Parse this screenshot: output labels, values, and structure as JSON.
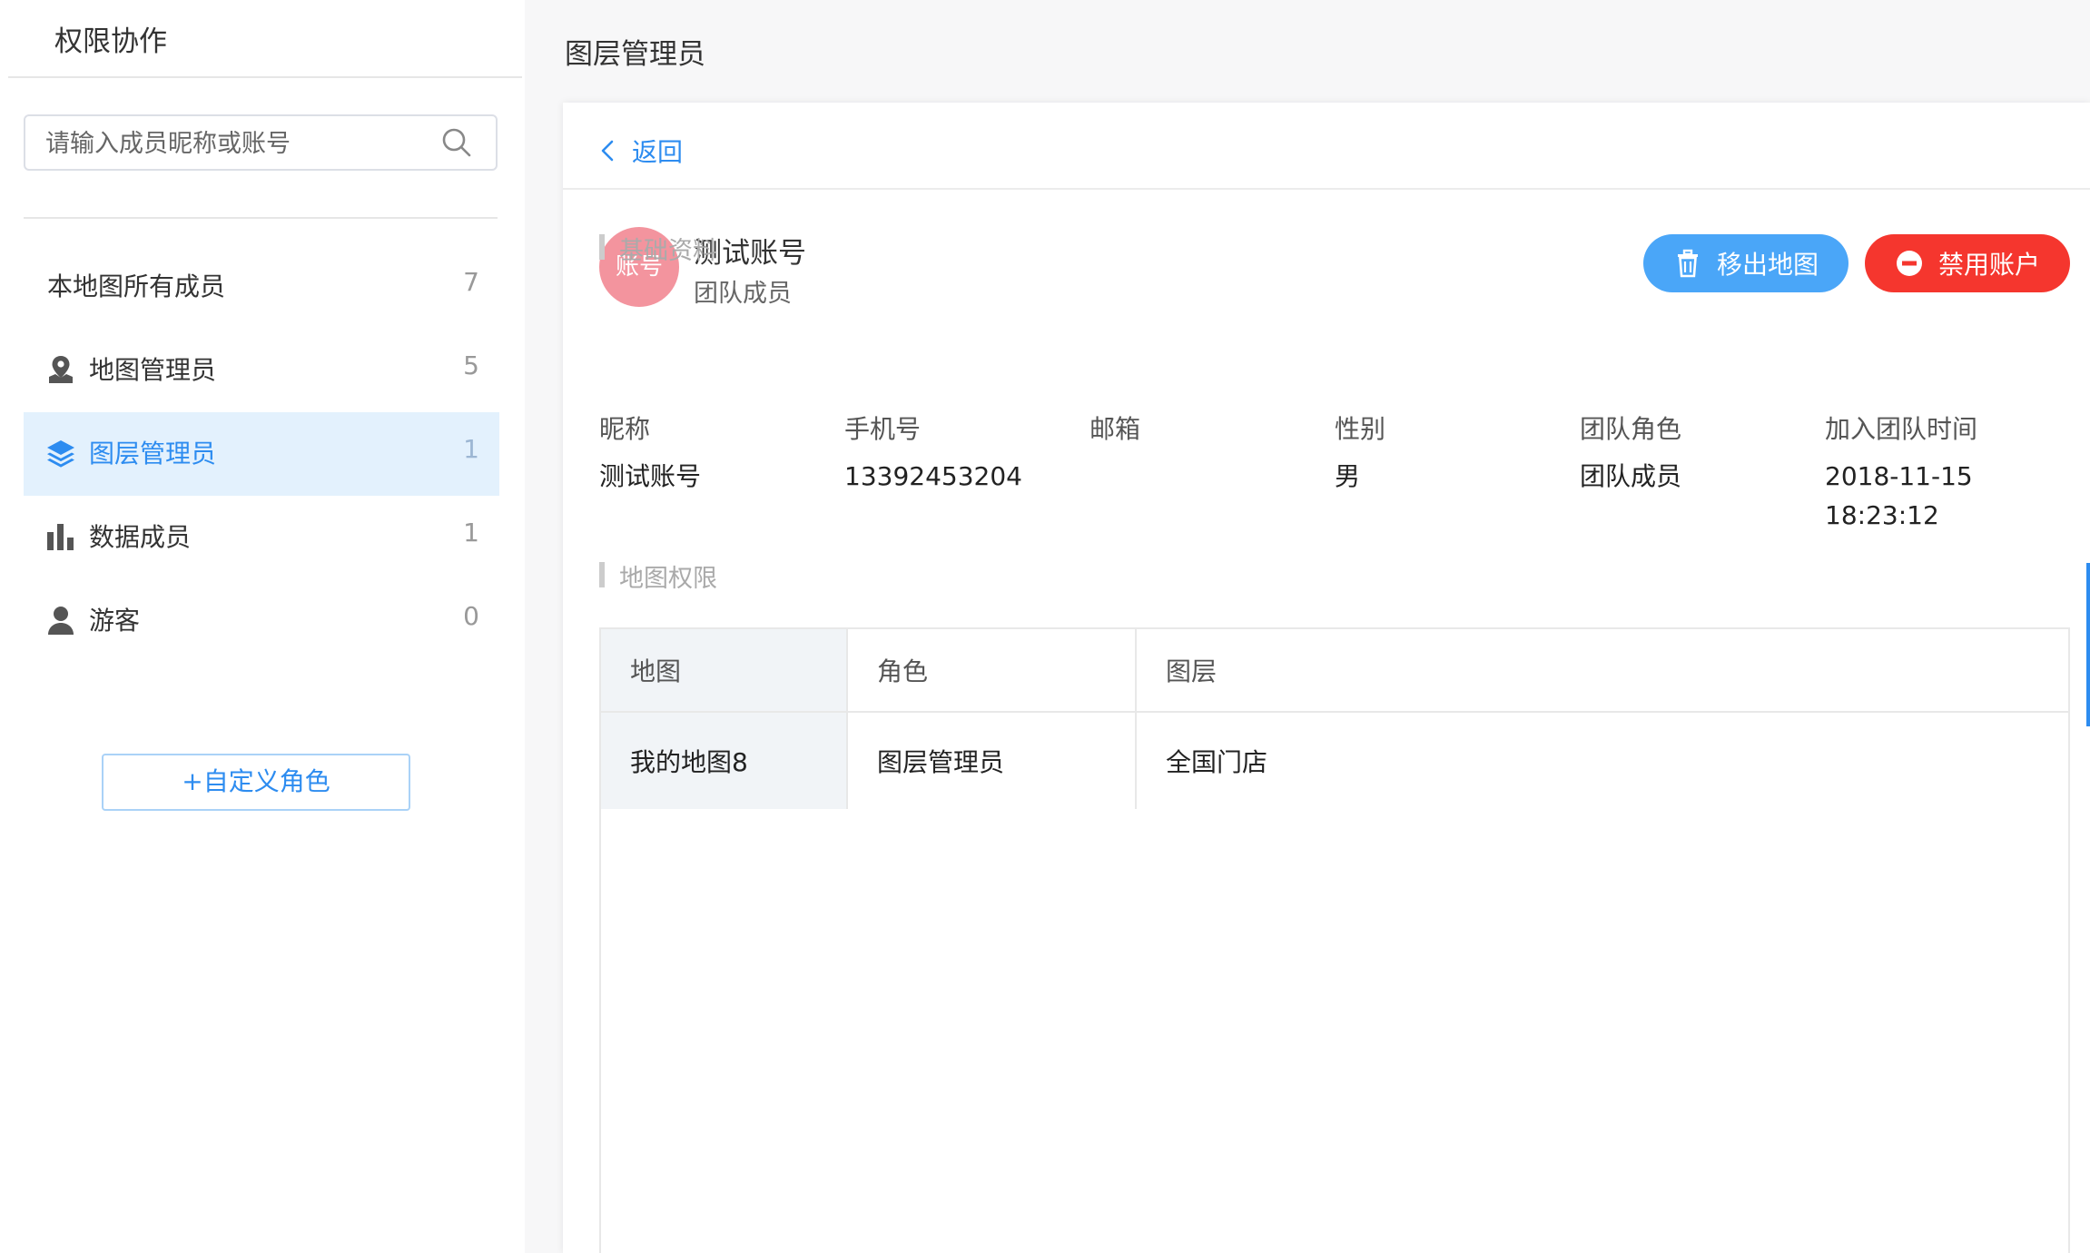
{
  "sidebar": {
    "title": "权限协作",
    "search_placeholder": "请输入成员昵称或账号",
    "items": [
      {
        "label": "本地图所有成员",
        "count": "7",
        "icon": "none"
      },
      {
        "label": "地图管理员",
        "count": "5",
        "icon": "map-pin-icon"
      },
      {
        "label": "图层管理员",
        "count": "1",
        "icon": "layers-icon",
        "active": true
      },
      {
        "label": "数据成员",
        "count": "1",
        "icon": "bar-chart-icon"
      },
      {
        "label": "游客",
        "count": "0",
        "icon": "user-icon"
      }
    ],
    "custom_role_button": "+自定义角色"
  },
  "main": {
    "page_title": "图层管理员",
    "back_label": "返回",
    "user": {
      "avatar_text": "账号",
      "name": "测试账号",
      "role": "团队成员"
    },
    "actions": {
      "remove_label": "移出地图",
      "disable_label": "禁用账户"
    },
    "basic_info": {
      "section_title": "基础资料",
      "labels": {
        "nickname": "昵称",
        "phone": "手机号",
        "email": "邮箱",
        "gender": "性别",
        "team_role": "团队角色",
        "join_time": "加入团队时间"
      },
      "values": {
        "nickname": "测试账号",
        "phone": "13392453204",
        "email": "",
        "gender": "男",
        "team_role": "团队成员",
        "join_date": "2018-11-15",
        "join_clock": "18:23:12"
      }
    },
    "map_permissions": {
      "section_title": "地图权限",
      "columns": [
        "地图",
        "角色",
        "图层"
      ],
      "rows": [
        [
          "我的地图8",
          "图层管理员",
          "全国门店"
        ]
      ]
    }
  },
  "colors": {
    "accent": "#2d8cf0",
    "active_item_bg": "#e3f1fd",
    "remove_button": "#4aa6f8",
    "disable_button": "#f5362e",
    "avatar": "#f3949e"
  }
}
